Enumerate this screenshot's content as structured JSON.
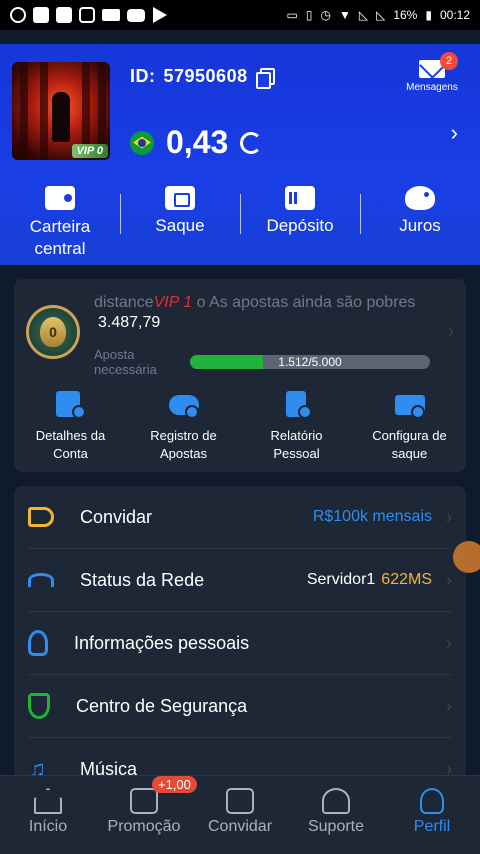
{
  "status_bar": {
    "battery": "16%",
    "time": "00:12"
  },
  "header": {
    "avatar_badge": "VIP 0",
    "id_label": "ID:",
    "id_value": "57950608",
    "balance": "0,43",
    "messages_label": "Mensagens",
    "messages_count": "2"
  },
  "quick_actions": [
    {
      "label": "Carteira central",
      "icon": "wallet-icon"
    },
    {
      "label": "Saque",
      "icon": "ticket-icon"
    },
    {
      "label": "Depósito",
      "icon": "card-icon"
    },
    {
      "label": "Juros",
      "icon": "piggy-bank-icon"
    }
  ],
  "vip": {
    "level_badge": "0",
    "prefix": "distance",
    "level_text": "VIP 1",
    "suffix": "o As apostas ainda são pobres",
    "amount": "3.487,79",
    "aposta_label": "Aposta necessária",
    "progress_text": "1.512/5.000",
    "progress": 0.3024
  },
  "account_actions": [
    {
      "label": "Detalhes da Conta"
    },
    {
      "label": "Registro de Apostas"
    },
    {
      "label": "Relatório Pessoal"
    },
    {
      "label": "Configura de saque"
    }
  ],
  "menu": {
    "items": [
      {
        "label": "Convidar",
        "right": "R$100k mensais",
        "icon": "megaphone-icon"
      },
      {
        "label": "Status da Rede",
        "right": "Servidor1",
        "right_extra": "622MS",
        "icon": "wifi-icon"
      },
      {
        "label": "Informações pessoais",
        "icon": "user-edit-icon"
      },
      {
        "label": "Centro de Segurança",
        "icon": "shield-icon"
      },
      {
        "label": "Música",
        "icon": "music-icon"
      }
    ]
  },
  "bottom_nav": {
    "items": [
      {
        "label": "Início"
      },
      {
        "label": "Promoção",
        "badge": "+1,00"
      },
      {
        "label": "Convidar"
      },
      {
        "label": "Suporte"
      },
      {
        "label": "Perfil"
      }
    ]
  },
  "colors": {
    "header_blue": "#1a3ee6",
    "accent_blue": "#2f8cf0",
    "progress_green": "#21b33a",
    "vip_red": "#e22f2f",
    "ping_amber": "#f5b531"
  }
}
